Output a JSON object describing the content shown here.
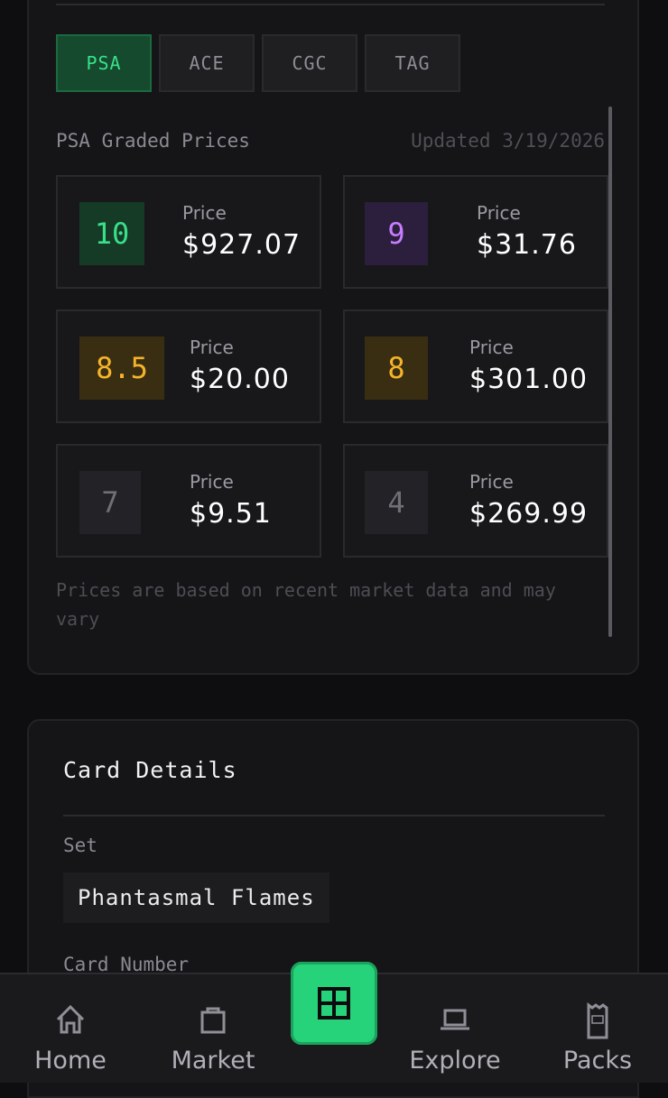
{
  "grading_tabs": [
    "PSA",
    "ACE",
    "CGC",
    "TAG"
  ],
  "active_tab_index": 0,
  "prices_section": {
    "label": "PSA Graded Prices",
    "updated": "Updated 3/19/2026",
    "price_label": "Price",
    "grades": [
      {
        "grade": "10",
        "price": "$927.07",
        "color": "#39e08a",
        "bg": "#153a26"
      },
      {
        "grade": "9",
        "price": "$31.76",
        "color": "#c77dff",
        "bg": "#2b1f3d"
      },
      {
        "grade": "8.5",
        "price": "$20.00",
        "color": "#f5b42a",
        "bg": "#3a2e12"
      },
      {
        "grade": "8",
        "price": "$301.00",
        "color": "#f5b42a",
        "bg": "#3a2e12"
      },
      {
        "grade": "7",
        "price": "$9.51",
        "color": "#6f6f76",
        "bg": "#232327"
      },
      {
        "grade": "4",
        "price": "$269.99",
        "color": "#6f6f76",
        "bg": "#232327"
      }
    ],
    "disclaimer": "Prices are based on recent market data and may vary"
  },
  "card_details": {
    "title": "Card Details",
    "set_label": "Set",
    "set_value": "Phantasmal Flames",
    "card_number_label": "Card Number"
  },
  "bottom_nav": {
    "items": [
      {
        "label": "Home",
        "icon": "home-icon"
      },
      {
        "label": "Market",
        "icon": "shopping-bag-icon"
      },
      {
        "label": "Explore",
        "icon": "laptop-icon"
      },
      {
        "label": "Packs",
        "icon": "rip-pack-icon"
      }
    ],
    "center_icon": "grid-icon",
    "accent_color": "#26d37b"
  }
}
